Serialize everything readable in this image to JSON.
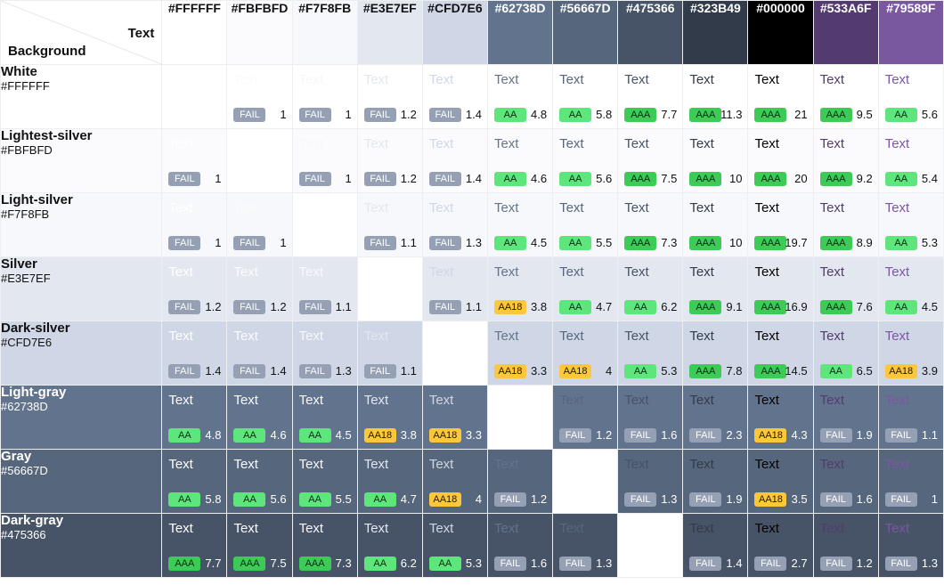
{
  "corner": {
    "text_label": "Text",
    "background_label": "Background"
  },
  "sample_text": "Text",
  "badge_colors": {
    "FAIL": "#95A0B5",
    "AA": "#5EE57C",
    "AAA": "#3DCA57",
    "AA18": "#FCC73C"
  },
  "columns": [
    {
      "hex": "#FFFFFF",
      "label_color": "#111111"
    },
    {
      "hex": "#FBFBFD",
      "label_color": "#111111"
    },
    {
      "hex": "#F7F8FB",
      "label_color": "#111111"
    },
    {
      "hex": "#E3E7EF",
      "label_color": "#111111"
    },
    {
      "hex": "#CFD7E6",
      "label_color": "#111111"
    },
    {
      "hex": "#62738D",
      "label_color": "#FFFFFF"
    },
    {
      "hex": "#56667D",
      "label_color": "#FFFFFF"
    },
    {
      "hex": "#475366",
      "label_color": "#FFFFFF"
    },
    {
      "hex": "#323B49",
      "label_color": "#FFFFFF"
    },
    {
      "hex": "#000000",
      "label_color": "#FFFFFF"
    },
    {
      "hex": "#533A6F",
      "label_color": "#FFFFFF"
    },
    {
      "hex": "#79589F",
      "label_color": "#FFFFFF"
    }
  ],
  "rows": [
    {
      "name": "White",
      "hex": "#FFFFFF",
      "label_color": "#111111",
      "cells": [
        null,
        {
          "badge": "FAIL",
          "ratio": "1"
        },
        {
          "badge": "FAIL",
          "ratio": "1"
        },
        {
          "badge": "FAIL",
          "ratio": "1.2"
        },
        {
          "badge": "FAIL",
          "ratio": "1.4"
        },
        {
          "badge": "AA",
          "ratio": "4.8"
        },
        {
          "badge": "AA",
          "ratio": "5.8"
        },
        {
          "badge": "AAA",
          "ratio": "7.7"
        },
        {
          "badge": "AAA",
          "ratio": "11.3"
        },
        {
          "badge": "AAA",
          "ratio": "21"
        },
        {
          "badge": "AAA",
          "ratio": "9.5"
        },
        {
          "badge": "AA",
          "ratio": "5.6"
        }
      ]
    },
    {
      "name": "Lightest-silver",
      "hex": "#FBFBFD",
      "label_color": "#111111",
      "cells": [
        {
          "badge": "FAIL",
          "ratio": "1"
        },
        null,
        {
          "badge": "FAIL",
          "ratio": "1"
        },
        {
          "badge": "FAIL",
          "ratio": "1.2"
        },
        {
          "badge": "FAIL",
          "ratio": "1.4"
        },
        {
          "badge": "AA",
          "ratio": "4.6"
        },
        {
          "badge": "AA",
          "ratio": "5.6"
        },
        {
          "badge": "AAA",
          "ratio": "7.5"
        },
        {
          "badge": "AAA",
          "ratio": "10"
        },
        {
          "badge": "AAA",
          "ratio": "20"
        },
        {
          "badge": "AAA",
          "ratio": "9.2"
        },
        {
          "badge": "AA",
          "ratio": "5.4"
        }
      ]
    },
    {
      "name": "Light-silver",
      "hex": "#F7F8FB",
      "label_color": "#111111",
      "cells": [
        {
          "badge": "FAIL",
          "ratio": "1"
        },
        {
          "badge": "FAIL",
          "ratio": "1"
        },
        null,
        {
          "badge": "FAIL",
          "ratio": "1.1"
        },
        {
          "badge": "FAIL",
          "ratio": "1.3"
        },
        {
          "badge": "AA",
          "ratio": "4.5"
        },
        {
          "badge": "AA",
          "ratio": "5.5"
        },
        {
          "badge": "AAA",
          "ratio": "7.3"
        },
        {
          "badge": "AAA",
          "ratio": "10"
        },
        {
          "badge": "AAA",
          "ratio": "19.7"
        },
        {
          "badge": "AAA",
          "ratio": "8.9"
        },
        {
          "badge": "AA",
          "ratio": "5.3"
        }
      ]
    },
    {
      "name": "Silver",
      "hex": "#E3E7EF",
      "label_color": "#111111",
      "cells": [
        {
          "badge": "FAIL",
          "ratio": "1.2"
        },
        {
          "badge": "FAIL",
          "ratio": "1.2"
        },
        {
          "badge": "FAIL",
          "ratio": "1.1"
        },
        null,
        {
          "badge": "FAIL",
          "ratio": "1.1"
        },
        {
          "badge": "AA18",
          "ratio": "3.8"
        },
        {
          "badge": "AA",
          "ratio": "4.7"
        },
        {
          "badge": "AA",
          "ratio": "6.2"
        },
        {
          "badge": "AAA",
          "ratio": "9.1"
        },
        {
          "badge": "AAA",
          "ratio": "16.9"
        },
        {
          "badge": "AAA",
          "ratio": "7.6"
        },
        {
          "badge": "AA",
          "ratio": "4.5"
        }
      ]
    },
    {
      "name": "Dark-silver",
      "hex": "#CFD7E6",
      "label_color": "#111111",
      "cells": [
        {
          "badge": "FAIL",
          "ratio": "1.4"
        },
        {
          "badge": "FAIL",
          "ratio": "1.4"
        },
        {
          "badge": "FAIL",
          "ratio": "1.3"
        },
        {
          "badge": "FAIL",
          "ratio": "1.1"
        },
        null,
        {
          "badge": "AA18",
          "ratio": "3.3"
        },
        {
          "badge": "AA18",
          "ratio": "4"
        },
        {
          "badge": "AA",
          "ratio": "5.3"
        },
        {
          "badge": "AAA",
          "ratio": "7.8"
        },
        {
          "badge": "AAA",
          "ratio": "14.5"
        },
        {
          "badge": "AA",
          "ratio": "6.5"
        },
        {
          "badge": "AA18",
          "ratio": "3.9"
        }
      ]
    },
    {
      "name": "Light-gray",
      "hex": "#62738D",
      "label_color": "#FFFFFF",
      "cells": [
        {
          "badge": "AA",
          "ratio": "4.8"
        },
        {
          "badge": "AA",
          "ratio": "4.6"
        },
        {
          "badge": "AA",
          "ratio": "4.5"
        },
        {
          "badge": "AA18",
          "ratio": "3.8"
        },
        {
          "badge": "AA18",
          "ratio": "3.3"
        },
        null,
        {
          "badge": "FAIL",
          "ratio": "1.2"
        },
        {
          "badge": "FAIL",
          "ratio": "1.6"
        },
        {
          "badge": "FAIL",
          "ratio": "2.3"
        },
        {
          "badge": "AA18",
          "ratio": "4.3"
        },
        {
          "badge": "FAIL",
          "ratio": "1.9"
        },
        {
          "badge": "FAIL",
          "ratio": "1.1"
        }
      ]
    },
    {
      "name": "Gray",
      "hex": "#56667D",
      "label_color": "#FFFFFF",
      "cells": [
        {
          "badge": "AA",
          "ratio": "5.8"
        },
        {
          "badge": "AA",
          "ratio": "5.6"
        },
        {
          "badge": "AA",
          "ratio": "5.5"
        },
        {
          "badge": "AA",
          "ratio": "4.7"
        },
        {
          "badge": "AA18",
          "ratio": "4"
        },
        {
          "badge": "FAIL",
          "ratio": "1.2"
        },
        null,
        {
          "badge": "FAIL",
          "ratio": "1.3"
        },
        {
          "badge": "FAIL",
          "ratio": "1.9"
        },
        {
          "badge": "AA18",
          "ratio": "3.5"
        },
        {
          "badge": "FAIL",
          "ratio": "1.6"
        },
        {
          "badge": "FAIL",
          "ratio": "1"
        }
      ]
    },
    {
      "name": "Dark-gray",
      "hex": "#475366",
      "label_color": "#FFFFFF",
      "cells": [
        {
          "badge": "AAA",
          "ratio": "7.7"
        },
        {
          "badge": "AAA",
          "ratio": "7.5"
        },
        {
          "badge": "AAA",
          "ratio": "7.3"
        },
        {
          "badge": "AA",
          "ratio": "6.2"
        },
        {
          "badge": "AA",
          "ratio": "5.3"
        },
        {
          "badge": "FAIL",
          "ratio": "1.6"
        },
        {
          "badge": "FAIL",
          "ratio": "1.3"
        },
        null,
        {
          "badge": "FAIL",
          "ratio": "1.4"
        },
        {
          "badge": "FAIL",
          "ratio": "2.7"
        },
        {
          "badge": "FAIL",
          "ratio": "1.2"
        },
        {
          "badge": "FAIL",
          "ratio": "1.3"
        }
      ]
    }
  ]
}
